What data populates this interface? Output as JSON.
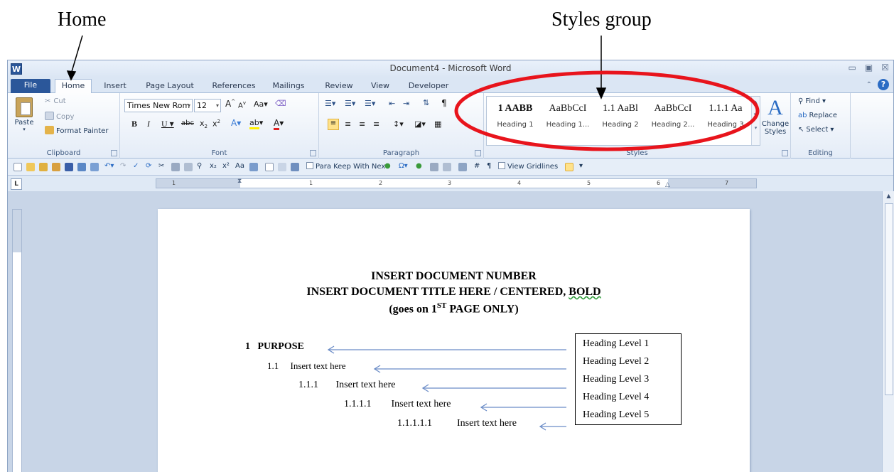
{
  "annotations": {
    "home": "Home",
    "styles_group": "Styles group"
  },
  "window": {
    "app_icon": "W",
    "title": "Document4 - Microsoft Word",
    "controls": [
      "▭",
      "▣",
      "☒"
    ]
  },
  "tabs": [
    "File",
    "Home",
    "Insert",
    "Page Layout",
    "References",
    "Mailings",
    "Review",
    "View",
    "Developer"
  ],
  "ribbon": {
    "clipboard": {
      "paste": "Paste",
      "cut": "Cut",
      "copy": "Copy",
      "format_painter": "Format Painter",
      "label": "Clipboard"
    },
    "font": {
      "name": "Times New Rom",
      "size": "12",
      "label": "Font"
    },
    "paragraph": {
      "label": "Paragraph"
    },
    "styles": {
      "label": "Styles",
      "items": [
        {
          "sample": "1 AABB",
          "name": "Heading 1"
        },
        {
          "sample": "AaBbCcI",
          "name": "Heading 1..."
        },
        {
          "sample": "1.1 AaBl",
          "name": "Heading 2"
        },
        {
          "sample": "AaBbCcI",
          "name": "Heading 2..."
        },
        {
          "sample": "1.1.1 Aa",
          "name": "Heading 3"
        }
      ],
      "change_styles": "Change Styles"
    },
    "editing": {
      "find": "Find",
      "replace": "Replace",
      "select": "Select",
      "label": "Editing"
    }
  },
  "qat": {
    "para_keep": "Para Keep With Next",
    "view_gridlines": "View Gridlines"
  },
  "ruler": {
    "numbers": [
      "1",
      "1",
      "2",
      "3",
      "4",
      "5",
      "6",
      "7"
    ],
    "tab_selector": "L"
  },
  "document": {
    "line1": "INSERT DOCUMENT NUMBER",
    "line2_prefix": "INSERT DOCUMENT TITLE HERE / CENTERED,",
    "line2_bold": "BOLD",
    "line3_prefix": "(goes on 1",
    "line3_sup": "ST",
    "line3_suffix": "PAGE ONLY)",
    "levels": [
      {
        "num": "1",
        "text": "PURPOSE"
      },
      {
        "num": "1.1",
        "text": "Insert text here"
      },
      {
        "num": "1.1.1",
        "text": "Insert text here"
      },
      {
        "num": "1.1.1.1",
        "text": "Insert text here"
      },
      {
        "num": "1.1.1.1.1",
        "text": "Insert text here"
      }
    ],
    "legend": [
      "Heading Level 1",
      "Heading Level 2",
      "Heading Level 3",
      "Heading Level 4",
      "Heading Level 5"
    ]
  }
}
